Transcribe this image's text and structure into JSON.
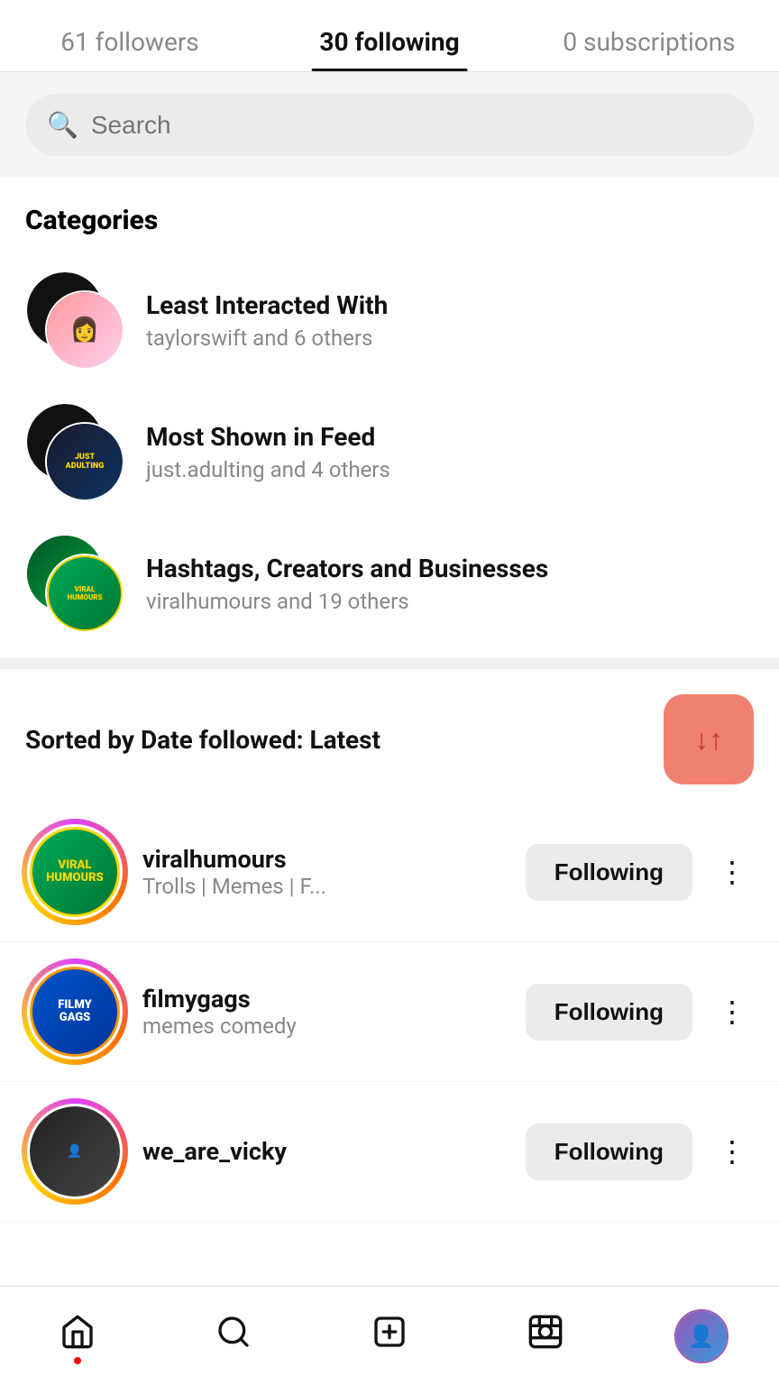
{
  "tabs": [
    {
      "id": "followers",
      "label": "61 followers",
      "active": false
    },
    {
      "id": "following",
      "label": "30 following",
      "active": true
    },
    {
      "id": "subscriptions",
      "label": "0 subscriptions",
      "active": false
    }
  ],
  "search": {
    "placeholder": "Search"
  },
  "categories": {
    "title": "Categories",
    "items": [
      {
        "name": "Least Interacted With",
        "sub": "taylorswift and 6 others"
      },
      {
        "name": "Most Shown in Feed",
        "sub": "just.adulting and 4 others"
      },
      {
        "name": "Hashtags, Creators and Businesses",
        "sub": "viralhumours and 19 others"
      }
    ]
  },
  "sorted": {
    "label": "Sorted by Date followed: Latest"
  },
  "following_list": [
    {
      "username": "viralhumours",
      "bio": "Trolls | Memes | F...",
      "button": "Following"
    },
    {
      "username": "filmygags",
      "bio": "memes comedy",
      "button": "Following"
    },
    {
      "username": "we_are_vicky",
      "bio": "",
      "button": "Following"
    }
  ],
  "bottom_nav": {
    "items": [
      {
        "id": "home",
        "icon": "⌂",
        "label": "Home",
        "has_dot": true
      },
      {
        "id": "search",
        "icon": "⌕",
        "label": "Search",
        "has_dot": false
      },
      {
        "id": "add",
        "icon": "⊕",
        "label": "Add",
        "has_dot": false
      },
      {
        "id": "reels",
        "icon": "▶",
        "label": "Reels",
        "has_dot": false
      },
      {
        "id": "profile",
        "icon": "👤",
        "label": "Profile",
        "has_dot": false
      }
    ]
  }
}
